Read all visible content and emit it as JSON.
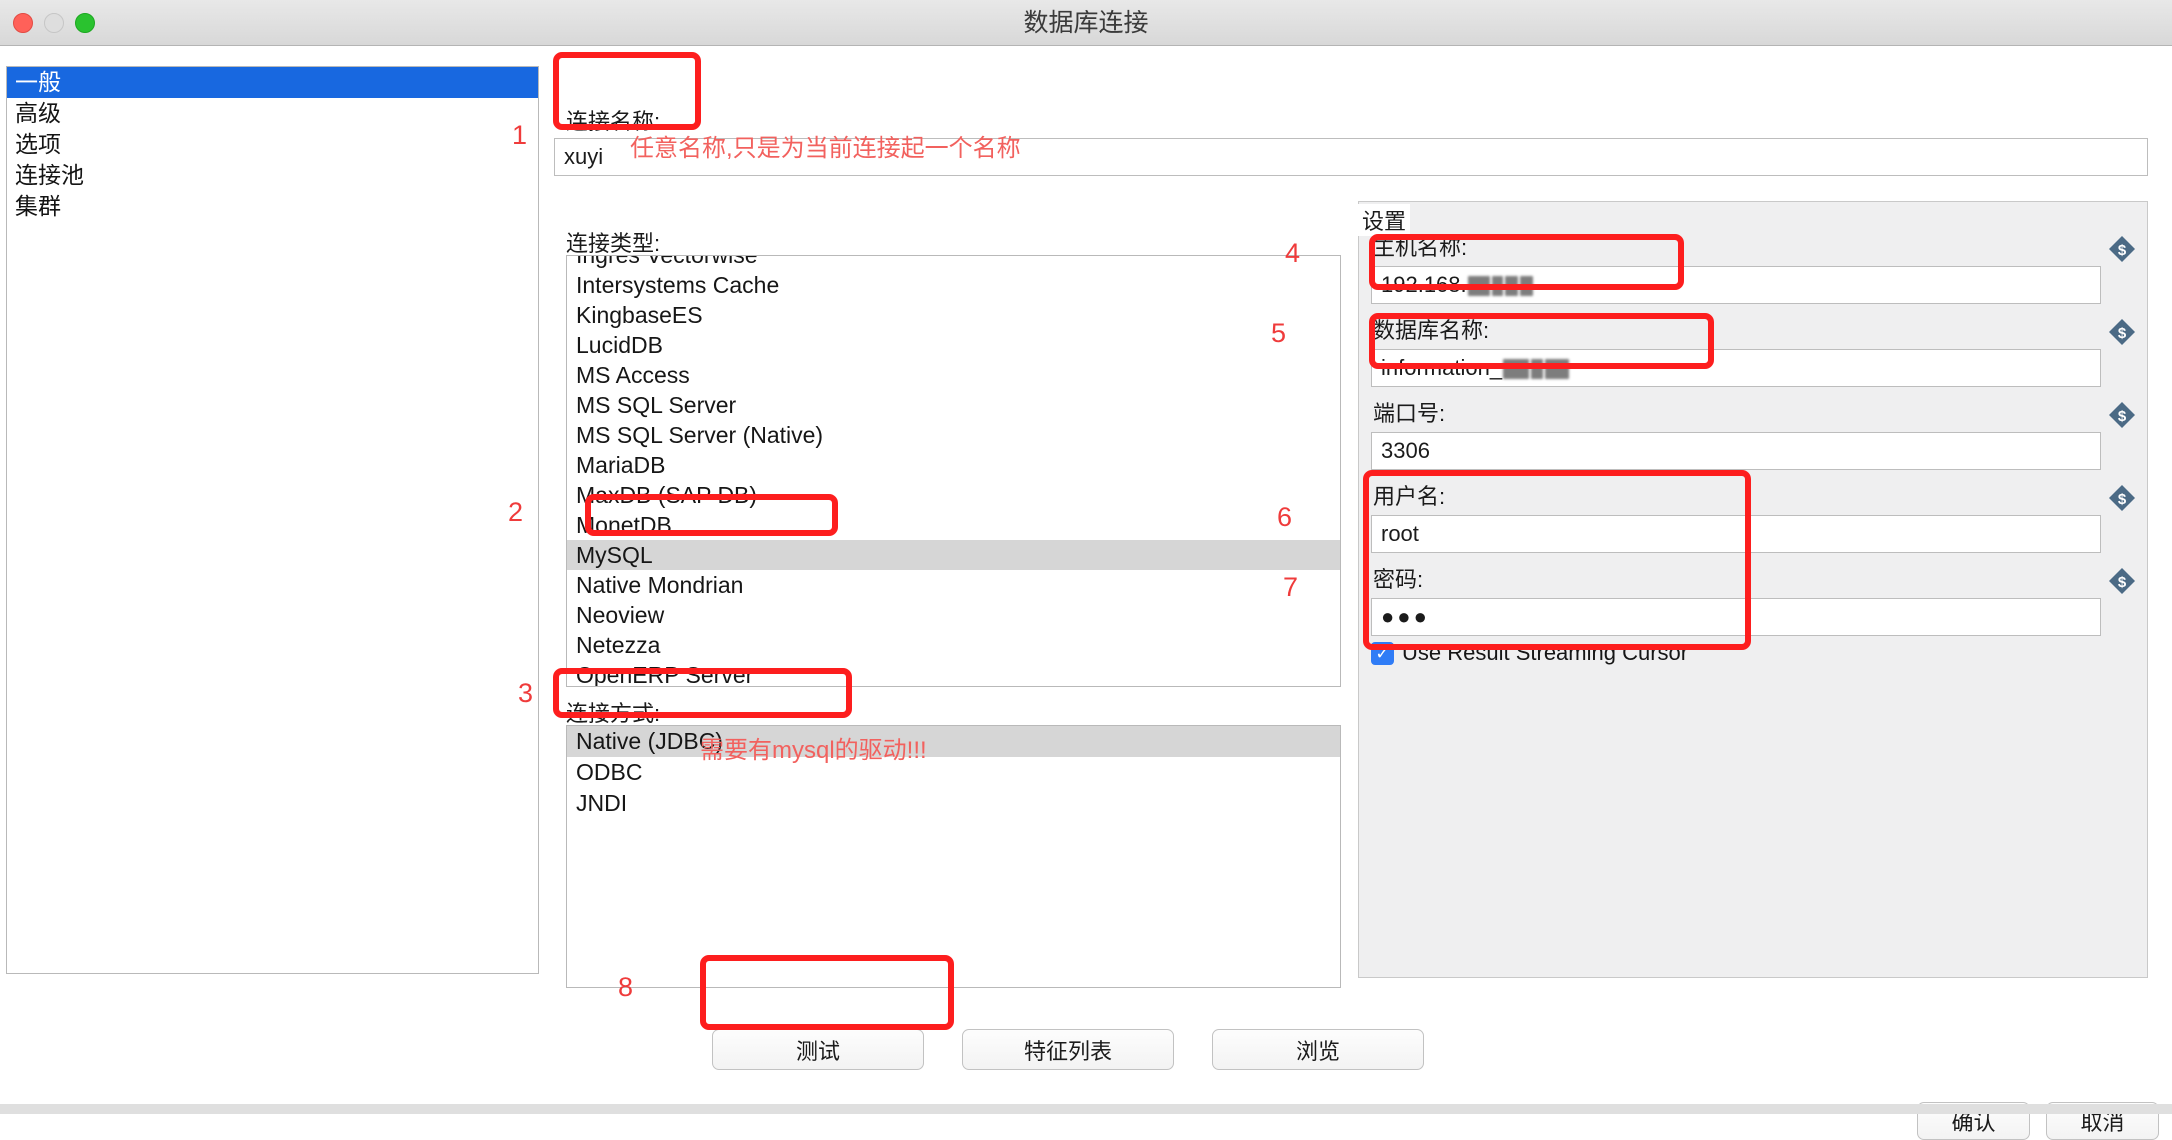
{
  "window": {
    "title": "数据库连接",
    "controls": {
      "close": "close-button",
      "minimize": "minimize-button",
      "maximize": "maximize-button"
    }
  },
  "sidebar": {
    "items": [
      {
        "label": "一般",
        "selected": true
      },
      {
        "label": "高级",
        "selected": false
      },
      {
        "label": "选项",
        "selected": false
      },
      {
        "label": "连接池",
        "selected": false
      },
      {
        "label": "集群",
        "selected": false
      }
    ]
  },
  "connection_name": {
    "label": "连接名称:",
    "value": "xuyi",
    "note": "任意名称,只是为当前连接起一个名称"
  },
  "connection_type": {
    "label": "连接类型:",
    "items": [
      "Ingres Vectorwise",
      "Intersystems Cache",
      "KingbaseES",
      "LucidDB",
      "MS Access",
      "MS SQL Server",
      "MS SQL Server (Native)",
      "MariaDB",
      "MaxDB (SAP DB)",
      "MonetDB",
      "MySQL",
      "Native Mondrian",
      "Neoview",
      "Netezza",
      "OpenERP Server"
    ],
    "selected": "MySQL"
  },
  "connection_method": {
    "label": "连接方式:",
    "items": [
      "Native (JDBC)",
      "ODBC",
      "JNDI"
    ],
    "selected": "Native (JDBC)",
    "note": "需要有mysql的驱动!!!"
  },
  "settings": {
    "title": "设置",
    "host": {
      "label": "主机名称:",
      "value_prefix": "192.168.",
      "value_masked": true
    },
    "database": {
      "label": "数据库名称:",
      "value_prefix": "information_",
      "value_masked": true
    },
    "port": {
      "label": "端口号:",
      "value": "3306"
    },
    "username": {
      "label": "用户名:",
      "value": "root"
    },
    "password": {
      "label": "密码:",
      "value": "●●●"
    },
    "streaming_cursor": {
      "label": "Use Result Streaming Cursor",
      "checked": true
    },
    "variable_icon": "dollar-diamond-icon"
  },
  "buttons": {
    "test": "测试",
    "feature_list": "特征列表",
    "browse": "浏览",
    "ok": "确认",
    "cancel": "取消"
  },
  "annotations": {
    "numbers": [
      "1",
      "2",
      "3",
      "4",
      "5",
      "6",
      "7",
      "8"
    ],
    "color": "#ef3b3b",
    "box_color": "#fd1e1e"
  }
}
